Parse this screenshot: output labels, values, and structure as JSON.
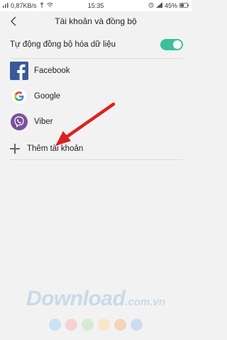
{
  "status_bar": {
    "speed": "0,87KB/s",
    "time": "15:35",
    "battery": "45%"
  },
  "header": {
    "title": "Tài khoản và đồng bộ"
  },
  "sync": {
    "label": "Tự động đồng bộ hóa dữ liệu",
    "enabled": true,
    "toggle_color": "#3cbf9d"
  },
  "accounts": [
    {
      "name": "Facebook",
      "icon": "facebook-icon",
      "color": "#3b5998"
    },
    {
      "name": "Google",
      "icon": "google-icon",
      "color": "#4285f4"
    },
    {
      "name": "Viber",
      "icon": "viber-icon",
      "color": "#7b519d"
    }
  ],
  "add_account": {
    "label": "Thêm tài khoản"
  },
  "annotation": {
    "arrow_color": "#e02020"
  },
  "watermark": {
    "text": "Download",
    "suffix": ".com.vn",
    "dot_colors": [
      "#b9dbf2",
      "#f7c6c6",
      "#c9e8c2",
      "#f9e3b3",
      "#f6c7a6",
      "#bcd4f0"
    ]
  }
}
